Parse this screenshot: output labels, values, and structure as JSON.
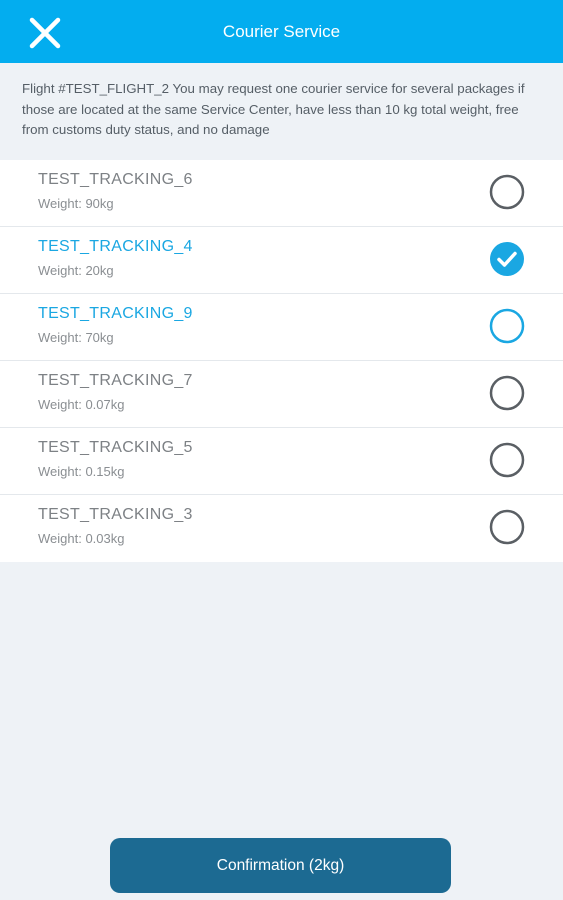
{
  "header": {
    "title": "Courier Service",
    "close_icon": "close-icon"
  },
  "notice": {
    "text": "Flight #TEST_FLIGHT_2 You may request one courier service for several packages if those are located at the same Service Center, have less than 10 kg total weight, free from customs duty status, and no damage"
  },
  "colors": {
    "header_bg": "#03adef",
    "accent": "#1aa7e2",
    "button_bg": "#1c6a92",
    "radio_unchecked": "#5a5f64"
  },
  "items": [
    {
      "tracking": "TEST_TRACKING_6",
      "weight": "Weight: 90kg",
      "state": "unchecked"
    },
    {
      "tracking": "TEST_TRACKING_4",
      "weight": "Weight: 20kg",
      "state": "checked"
    },
    {
      "tracking": "TEST_TRACKING_9",
      "weight": "Weight: 70kg",
      "state": "highlighted"
    },
    {
      "tracking": "TEST_TRACKING_7",
      "weight": "Weight: 0.07kg",
      "state": "unchecked"
    },
    {
      "tracking": "TEST_TRACKING_5",
      "weight": "Weight: 0.15kg",
      "state": "unchecked"
    },
    {
      "tracking": "TEST_TRACKING_3",
      "weight": "Weight: 0.03kg",
      "state": "unchecked"
    }
  ],
  "footer": {
    "confirm_label": "Confirmation (2kg)"
  }
}
